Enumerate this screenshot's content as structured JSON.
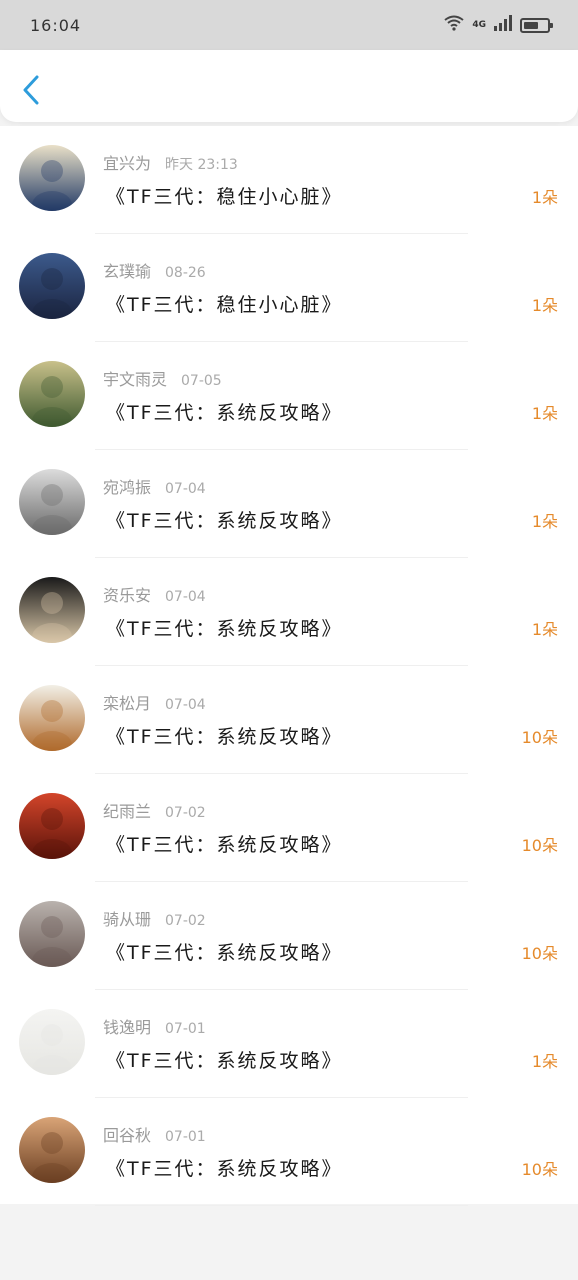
{
  "status_bar": {
    "time": "16:04",
    "network": "4G"
  },
  "header": {
    "back_icon": "chevron-left-icon",
    "accent": "#2d9cdb"
  },
  "items": [
    {
      "name": "宜兴为",
      "date": "昨天 23:13",
      "title": "《TF三代：稳住小心脏》",
      "count": "1朵",
      "avatar": [
        "#e9e0c8",
        "#223a66"
      ]
    },
    {
      "name": "玄璞瑜",
      "date": "08-26",
      "title": "《TF三代：稳住小心脏》",
      "count": "1朵",
      "avatar": [
        "#3c5a8c",
        "#1b2440"
      ]
    },
    {
      "name": "宇文雨灵",
      "date": "07-05",
      "title": "《TF三代：系统反攻略》",
      "count": "1朵",
      "avatar": [
        "#c8c08a",
        "#3f5a30"
      ]
    },
    {
      "name": "宛鸿振",
      "date": "07-04",
      "title": "《TF三代：系统反攻略》",
      "count": "1朵",
      "avatar": [
        "#dcdcdc",
        "#6a6a6a"
      ]
    },
    {
      "name": "资乐安",
      "date": "07-04",
      "title": "《TF三代：系统反攻略》",
      "count": "1朵",
      "avatar": [
        "#1a1a1a",
        "#d9c7a8"
      ]
    },
    {
      "name": "栾松月",
      "date": "07-04",
      "title": "《TF三代：系统反攻略》",
      "count": "10朵",
      "avatar": [
        "#f2efe6",
        "#b06a2c"
      ]
    },
    {
      "name": "纪雨兰",
      "date": "07-02",
      "title": "《TF三代：系统反攻略》",
      "count": "10朵",
      "avatar": [
        "#d3452a",
        "#5a130a"
      ]
    },
    {
      "name": "骑从珊",
      "date": "07-02",
      "title": "《TF三代：系统反攻略》",
      "count": "10朵",
      "avatar": [
        "#b9b2ad",
        "#6a5a55"
      ]
    },
    {
      "name": "钱逸明",
      "date": "07-01",
      "title": "《TF三代：系统反攻略》",
      "count": "1朵",
      "avatar": [
        "#f4f4f2",
        "#e6e6e2"
      ]
    },
    {
      "name": "回谷秋",
      "date": "07-01",
      "title": "《TF三代：系统反攻略》",
      "count": "10朵",
      "avatar": [
        "#d9a477",
        "#6b3f22"
      ]
    }
  ],
  "colors": {
    "count": "#e58a2b",
    "name": "#9a9a9a",
    "title": "#1a1a1a"
  }
}
